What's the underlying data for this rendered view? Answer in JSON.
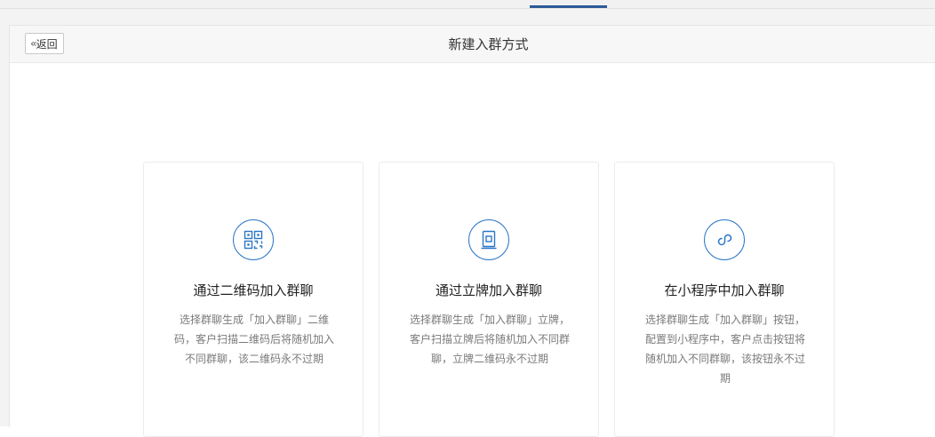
{
  "header": {
    "back_label": "返回",
    "title": "新建入群方式"
  },
  "cards": [
    {
      "title": "通过二维码加入群聊",
      "description": "选择群聊生成「加入群聊」二维码，客户扫描二维码后将随机加入不同群聊，该二维码永不过期",
      "icon": "qr-code-icon"
    },
    {
      "title": "通过立牌加入群聊",
      "description": "选择群聊生成「加入群聊」立牌，客户扫描立牌后将随机加入不同群聊，立牌二维码永不过期",
      "icon": "standee-icon"
    },
    {
      "title": "在小程序中加入群聊",
      "description": "选择群聊生成「加入群聊」按钮，配置到小程序中，客户点击按钮将随机加入不同群聊，该按钮永不过期",
      "icon": "mini-program-icon"
    }
  ],
  "colors": {
    "accent": "#2b76c6",
    "tab_indicator": "#2d5a99"
  }
}
